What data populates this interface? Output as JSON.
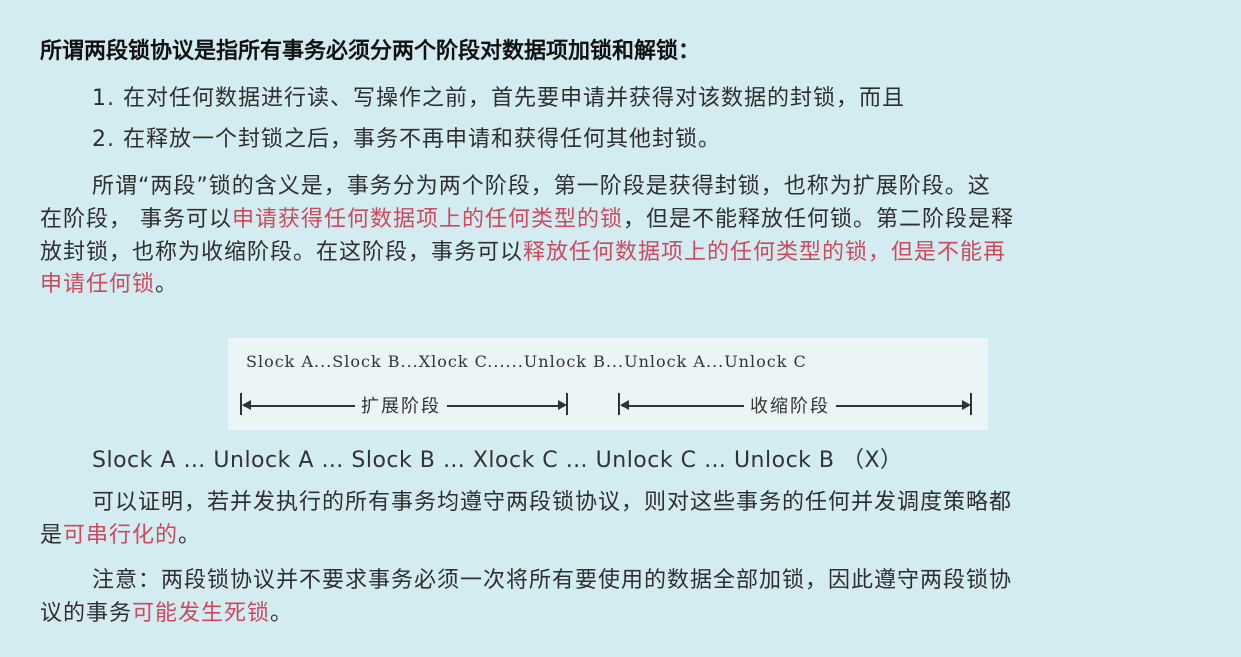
{
  "heading": "所谓两段锁协议是指所有事务必须分两个阶段对数据项加锁和解锁：",
  "items": [
    "1. 在对任何数据进行读、写操作之前，首先要申请并获得对该数据的封锁，而且",
    "2. 在释放一个封锁之后，事务不再申请和获得任何其他封锁。"
  ],
  "para1": {
    "l1": "所谓“两段”锁的含义是，事务分为两个阶段，第一阶段是获得封锁，也称为扩展阶段。这",
    "l2_a": "在阶段， 事务可以",
    "l2_red": "申请获得任何数据项上的任何类型的锁",
    "l2_b": "，但是不能释放任何锁。第二阶段是释",
    "l3_a": "放封锁，也称为收缩阶段。在这阶段，事务可以",
    "l3_red": "释放任何数据项上的任何类型的锁，但是不能再",
    "l4_red": "申请任何锁",
    "l4_b": "。"
  },
  "diagram": {
    "sequence": "Slock A...Slock B...Xlock C......Unlock B...Unlock A...Unlock C",
    "phase1": "扩展阶段",
    "phase2": "收缩阶段"
  },
  "example": "Slock A … Unlock A … Slock B … Xlock C … Unlock C … Unlock B （X）",
  "para2": {
    "l1": "可以证明，若并发执行的所有事务均遵守两段锁协议，则对这些事务的任何并发调度策略都",
    "l2_a": "是",
    "l2_red": "可串行化的",
    "l2_b": "。"
  },
  "para3": {
    "l1": "注意：两段锁协议并不要求事务必须一次将所有要使用的数据全部加锁，因此遵守两段锁协",
    "l2_a": "议的事务",
    "l2_red": "可能发生死锁",
    "l2_b": "。"
  },
  "colors": {
    "background": "#d3ecf1",
    "emphasis": "#cc4a5c",
    "text": "#2f2f2f"
  }
}
